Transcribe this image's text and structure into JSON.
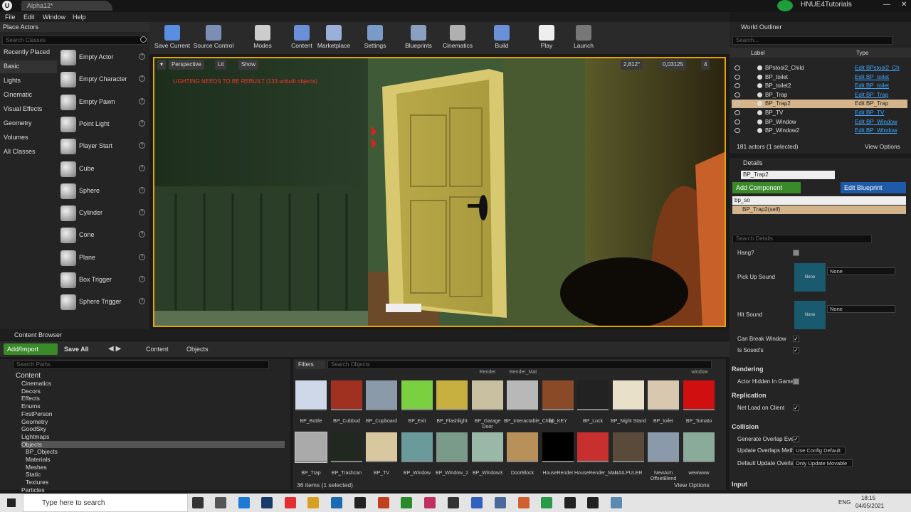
{
  "app": {
    "tab": "Alpha12*",
    "user": "HNUE4Tutorials",
    "menu": [
      "File",
      "Edit",
      "Window",
      "Help"
    ]
  },
  "place_actors": {
    "title": "Place Actors",
    "search_placeholder": "Search Classes",
    "categories": [
      "Recently Placed",
      "Basic",
      "Lights",
      "Cinematic",
      "Visual Effects",
      "Geometry",
      "Volumes",
      "All Classes"
    ],
    "actors": [
      "Empty Actor",
      "Empty Character",
      "Empty Pawn",
      "Point Light",
      "Player Start",
      "Cube",
      "Sphere",
      "Cylinder",
      "Cone",
      "Plane",
      "Box Trigger",
      "Sphere Trigger"
    ]
  },
  "toolbar": [
    {
      "label": "Save Current",
      "color": "#5a8ee0"
    },
    {
      "label": "Source Control",
      "color": "#7b8fb5"
    },
    {
      "label": "Modes",
      "color": "#cccccc"
    },
    {
      "label": "Content",
      "color": "#6b90d8"
    },
    {
      "label": "Marketplace",
      "color": "#9ab0d8"
    },
    {
      "label": "Settings",
      "color": "#7a9ac8"
    },
    {
      "label": "Blueprints",
      "color": "#8aa0c0"
    },
    {
      "label": "Cinematics",
      "color": "#b0b0b0"
    },
    {
      "label": "Build",
      "color": "#6a90d8"
    },
    {
      "label": "Play",
      "color": "#eeeeee"
    },
    {
      "label": "Launch",
      "color": "#777777"
    }
  ],
  "viewport": {
    "perspective": "Perspective",
    "lit": "Lit",
    "show": "Show",
    "warning": "LIGHTING NEEDS TO BE REBUILT (133 unbuilt objects)",
    "angle": "2,812°",
    "scale": "0,03125",
    "cam": "4"
  },
  "content_browser": {
    "tab": "Content Browser",
    "add_import": "Add/Import",
    "save_all": "Save All",
    "path": [
      "Content",
      "Objects"
    ],
    "search_paths": "Search Paths",
    "filters": "Filters",
    "search_objects": "Search Objects",
    "items_count": "36 items (1 selected)",
    "view_options": "View Options",
    "tree": [
      "Content",
      "Cinematics",
      "Decors",
      "Effects",
      "Enums",
      "FirstPerson",
      "Geometry",
      "GoodSky",
      "Lightmaps",
      "Objects",
      "BP_Objects",
      "Materials",
      "Meshes",
      "Static",
      "Textures",
      "Particles"
    ],
    "top_row_cut": [
      "Render",
      "Render_Mat",
      "window"
    ],
    "row1": [
      "BP_Bottle",
      "BP_Cubbud",
      "BP_Cupboard",
      "BP_Exit",
      "BP_Flashlight",
      "BP_Garage Door",
      "BP_Interactable_Child",
      "bp_KEY",
      "BP_Lock",
      "BP_Night Stand",
      "BP_toilet",
      "BP_Tomato"
    ],
    "row2": [
      "BP_Trap",
      "BP_Trashcan",
      "BP_TV",
      "BP_Window",
      "BP_Window_2",
      "BP_Window3",
      "DoorBlock",
      "HouseRender",
      "HouseRender_Mat",
      "NAILPULER",
      "NewAim OffsetBlend",
      "wewwww"
    ]
  },
  "outliner": {
    "title": "World Outliner",
    "search": "Search...",
    "col_label": "Label",
    "col_type": "Type",
    "rows": [
      {
        "name": "BPstool2_Child",
        "type": "Edit BPstool2_Ch"
      },
      {
        "name": "BP_toilet",
        "type": "Edit BP_toilet"
      },
      {
        "name": "BP_toilet2",
        "type": "Edit BP_toilet"
      },
      {
        "name": "BP_Trap",
        "type": "Edit BP_Trap"
      },
      {
        "name": "BP_Trap2",
        "type": "Edit BP_Trap"
      },
      {
        "name": "BP_TV",
        "type": "Edit BP_TV"
      },
      {
        "name": "BP_Window",
        "type": "Edit BP_Window"
      },
      {
        "name": "BP_Window2",
        "type": "Edit BP_Window"
      }
    ],
    "count": "181 actors (1 selected)",
    "view_options": "View Options"
  },
  "details": {
    "title": "Details",
    "name": "BP_Trap2",
    "add_component": "Add Component",
    "edit_blueprint": "Edit Blueprint",
    "filter": "bp_so",
    "self": "BP_Trap2(self)",
    "search": "Search Details",
    "hang": "Hang?",
    "pick_up_sound": "Pick Up Sound",
    "hit_sound": "Hit Sound",
    "none": "None",
    "can_break": "Can Break Window",
    "is_sosed": "Is Sosed's",
    "rendering": "Rendering",
    "actor_hidden": "Actor Hidden In Game",
    "replication": "Replication",
    "net_load": "Net Load on Client",
    "collision": "Collision",
    "gen_overlap": "Generate Overlap Ever",
    "update_overlaps": "Update Overlaps Meth",
    "update_overlaps_val": "Use Config Default",
    "default_update": "Default Update Overla",
    "default_update_val": "Only Update Movable",
    "input": "Input"
  },
  "taskbar": {
    "search": "Type here to search",
    "lang": "ENG",
    "time": "18:15",
    "date": "04/05/2021"
  }
}
